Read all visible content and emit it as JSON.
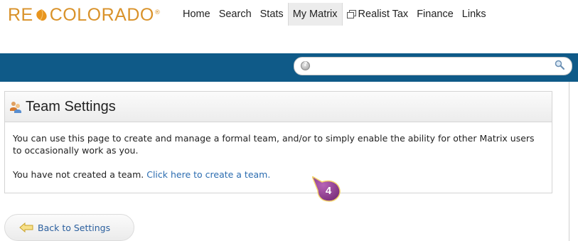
{
  "header": {
    "logo": {
      "left_text": "RE",
      "right_text": "COLORADO",
      "reg_mark": "®"
    },
    "nav": [
      {
        "label": "Home"
      },
      {
        "label": "Search"
      },
      {
        "label": "Stats"
      },
      {
        "label": "My Matrix",
        "active": true
      },
      {
        "label": "Realist Tax",
        "icon": "external-window-icon"
      },
      {
        "label": "Finance"
      },
      {
        "label": "Links"
      }
    ]
  },
  "search": {
    "value": "",
    "help_icon": "help-icon",
    "search_icon": "magnifier-icon"
  },
  "panel": {
    "title": "Team Settings",
    "title_icon": "team-icon",
    "description": "You can use this page to create and manage a formal team, and/or to simply enable the ability for other Matrix users to occasionally work as you.",
    "status_text": "You have not created a team.",
    "create_link": "Click here to create a team."
  },
  "callout": {
    "number": "4",
    "color": "#8e3d8e"
  },
  "back_button": {
    "label": "Back to Settings",
    "icon": "back-arrow-icon"
  },
  "colors": {
    "brand": "#d9922a",
    "bar": "#0f5a88",
    "link": "#2b6cb0"
  }
}
